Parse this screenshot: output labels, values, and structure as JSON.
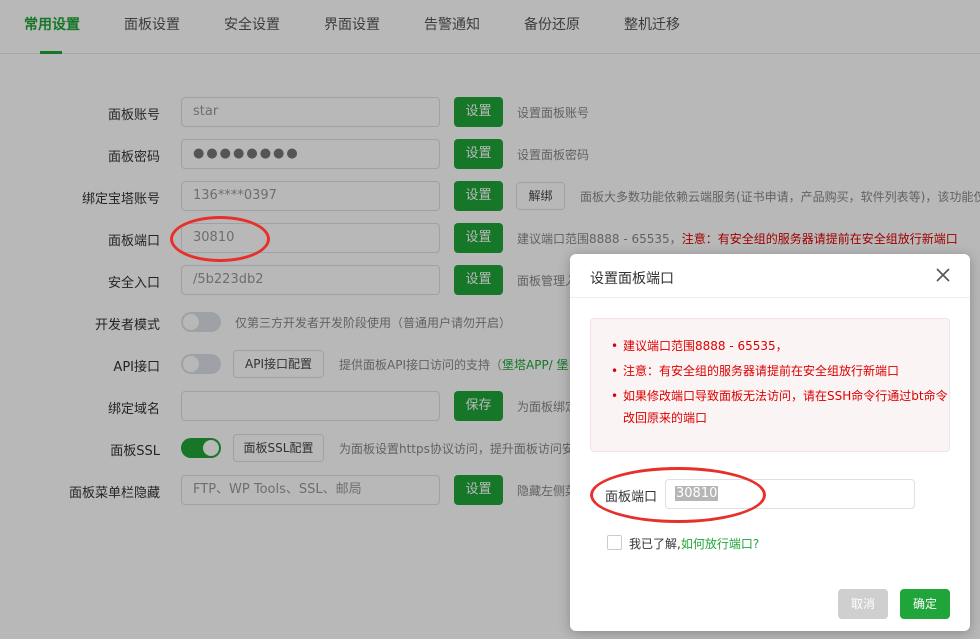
{
  "tabs": [
    "常用设置",
    "面板设置",
    "安全设置",
    "界面设置",
    "告警通知",
    "备份还原",
    "整机迁移"
  ],
  "settings": {
    "account": {
      "label": "面板账号",
      "value": "star",
      "button": "设置",
      "desc": "设置面板账号"
    },
    "password": {
      "label": "面板密码",
      "value": "●●●●●●●●",
      "button": "设置",
      "desc": "设置面板密码"
    },
    "bt_account": {
      "label": "绑定宝塔账号",
      "value": "136****0397",
      "button": "设置",
      "unbind": "解绑",
      "desc": "面板大多数功能依赖云端服务(证书申请，产品购买，软件列表等)，该功能仅"
    },
    "port": {
      "label": "面板端口",
      "value": "30810",
      "button": "设置",
      "desc": "建议端口范围8888 - 65535，",
      "warn": "注意：有安全组的服务器请提前在安全组放行新端口"
    },
    "entry": {
      "label": "安全入口",
      "value": "/5b223db2",
      "button": "设置",
      "desc": "面板管理入"
    },
    "dev_mode": {
      "label": "开发者模式",
      "desc": "仅第三方开发者开发阶段使用（普通用户请勿开启）"
    },
    "api": {
      "label": "API接口",
      "button": "API接口配置",
      "desc": "提供面板API接口访问的支持（",
      "link": "堡塔APP/ 堡"
    },
    "domain": {
      "label": "绑定域名",
      "value": "",
      "button": "保存",
      "desc": "为面板绑定"
    },
    "ssl": {
      "label": "面板SSL",
      "button": "面板SSL配置",
      "desc": "为面板设置https协议访问，提升面板访问安"
    },
    "menu_hide": {
      "label": "面板菜单栏隐藏",
      "placeholder": "FTP、WP Tools、SSL、邮局",
      "button": "设置",
      "desc": "隐藏左侧菜"
    }
  },
  "dialog": {
    "title": "设置面板端口",
    "warnings": [
      "建议端口范围8888 - 65535，",
      "注意：有安全组的服务器请提前在安全组放行新端口",
      "如果修改端口导致面板无法访问，请在SSH命令行通过bt命令改回原来的端口"
    ],
    "port_label": "面板端口",
    "port_value": "30810",
    "confirm_text": "我已了解,",
    "confirm_link": "如何放行端口?",
    "cancel": "取消",
    "ok": "确定"
  },
  "colors": {
    "accent": "#20a53a",
    "warning": "#dd0000",
    "annotation": "#e8302a"
  }
}
